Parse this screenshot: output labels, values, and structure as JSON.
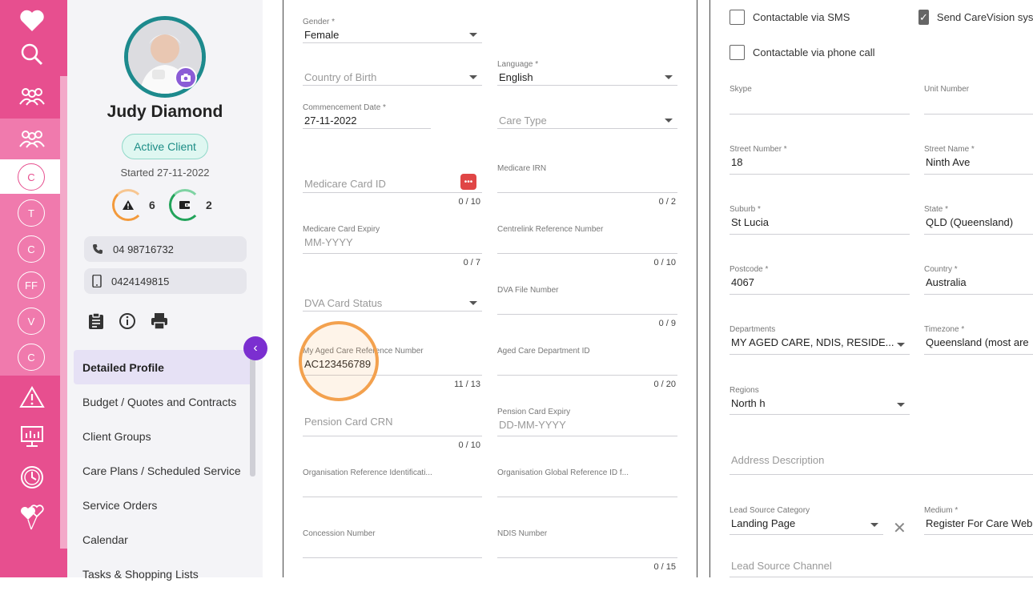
{
  "rail": {
    "circle_items": [
      "C",
      "T",
      "C",
      "FF",
      "V",
      "C"
    ],
    "icons": [
      "heart-icon",
      "search-icon",
      "users-icon",
      "users-icon",
      "alert-icon",
      "monitor-icon",
      "clock-icon",
      "balloon-hearts-icon"
    ]
  },
  "profile": {
    "name": "Judy Diamond",
    "status": "Active Client",
    "started": "Started 27-11-2022",
    "alerts_count": "6",
    "wallet_count": "2",
    "phone": "04 98716732",
    "mobile": "0424149815"
  },
  "menu": {
    "items": [
      "Detailed Profile",
      "Budget / Quotes and Contracts",
      "Client Groups",
      "Care Plans / Scheduled Service",
      "Service Orders",
      "Calendar",
      "Tasks & Shopping Lists"
    ]
  },
  "form": {
    "gender": {
      "label": "Gender *",
      "value": "Female"
    },
    "country_birth": {
      "placeholder": "Country of Birth"
    },
    "language": {
      "label": "Language *",
      "value": "English"
    },
    "commencement": {
      "label": "Commencement Date *",
      "value": "27-11-2022"
    },
    "care_type": {
      "placeholder": "Care Type"
    },
    "medicare_id": {
      "placeholder": "Medicare Card ID",
      "count": "0 / 10"
    },
    "medicare_irn": {
      "label": "Medicare IRN",
      "count": "0 / 2"
    },
    "medicare_expiry": {
      "label": "Medicare Card Expiry",
      "placeholder": "MM-YYYY",
      "count": "0 / 7"
    },
    "centrelink": {
      "label": "Centrelink Reference Number",
      "count": "0 / 10"
    },
    "dva_status": {
      "placeholder": "DVA Card Status"
    },
    "dva_file": {
      "label": "DVA File Number",
      "count": "0 / 9"
    },
    "my_aged_care": {
      "label": "My Aged Care Reference Number",
      "value": "AC123456789",
      "count": "11 / 13"
    },
    "aged_care_dept": {
      "label": "Aged Care Department ID",
      "count": "0 / 20"
    },
    "pension_crn": {
      "placeholder": "Pension Card CRN",
      "count": "0 / 10"
    },
    "pension_expiry": {
      "label": "Pension Card Expiry",
      "placeholder": "DD-MM-YYYY"
    },
    "org_ref": {
      "label": "Organisation Reference Identificati..."
    },
    "org_global": {
      "label": "Organisation Global Reference ID f..."
    },
    "concession": {
      "label": "Concession Number"
    },
    "ndis": {
      "label": "NDIS Number",
      "count": "0 / 15"
    }
  },
  "contact": {
    "sms": "Contactable via SMS",
    "send_carevision": "Send CareVision syst",
    "phone_call": "Contactable via phone call",
    "skype": {
      "label": "Skype"
    },
    "unit": {
      "label": "Unit Number"
    },
    "street_number": {
      "label": "Street Number *",
      "value": "18"
    },
    "street_name": {
      "label": "Street Name *",
      "value": "Ninth Ave"
    },
    "suburb": {
      "label": "Suburb *",
      "value": "St Lucia"
    },
    "state": {
      "label": "State *",
      "value": "QLD (Queensland)"
    },
    "postcode": {
      "label": "Postcode *",
      "value": "4067"
    },
    "country": {
      "label": "Country *",
      "value": "Australia"
    },
    "departments": {
      "label": "Departments",
      "value": "MY AGED CARE, NDIS, RESIDE..."
    },
    "timezone": {
      "label": "Timezone *",
      "value": "Queensland (most are"
    },
    "regions": {
      "label": "Regions",
      "value": "North h"
    },
    "address_desc": {
      "placeholder": "Address Description"
    },
    "lead_category": {
      "label": "Lead Source Category",
      "value": "Landing Page"
    },
    "medium": {
      "label": "Medium *",
      "value": "Register For Care Web"
    },
    "lead_channel": {
      "placeholder": "Lead Source Channel"
    }
  },
  "colors": {
    "rail": "#e74f8f",
    "accent": "#7b2fd0",
    "teal": "#1d8a8d",
    "highlight": "#f3a14e"
  }
}
